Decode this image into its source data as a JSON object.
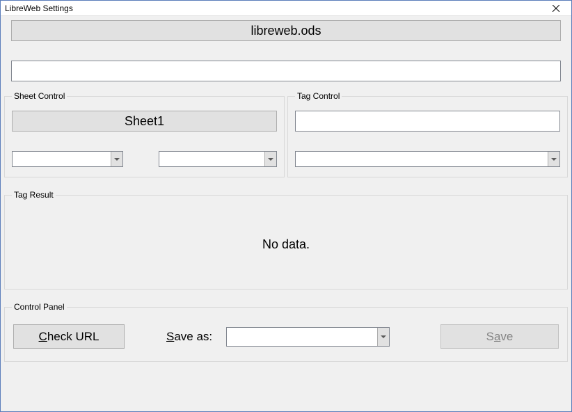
{
  "window": {
    "title": "LibreWeb Settings"
  },
  "top": {
    "file_button_label": "libreweb.ods",
    "url_value": ""
  },
  "sheet_control": {
    "legend": "Sheet Control",
    "sheet_button_label": "Sheet1",
    "combo1_value": "",
    "combo2_value": ""
  },
  "tag_control": {
    "legend": "Tag Control",
    "input_value": "",
    "combo_value": ""
  },
  "tag_result": {
    "legend": "Tag Result",
    "body_text": "No data."
  },
  "control_panel": {
    "legend": "Control Panel",
    "check_url_prefix": "C",
    "check_url_rest": "heck URL",
    "save_as_prefix": "S",
    "save_as_rest": "ave as:",
    "save_as_combo_value": "",
    "save_prefix": "S",
    "save_mid": "a",
    "save_rest": "ve"
  }
}
